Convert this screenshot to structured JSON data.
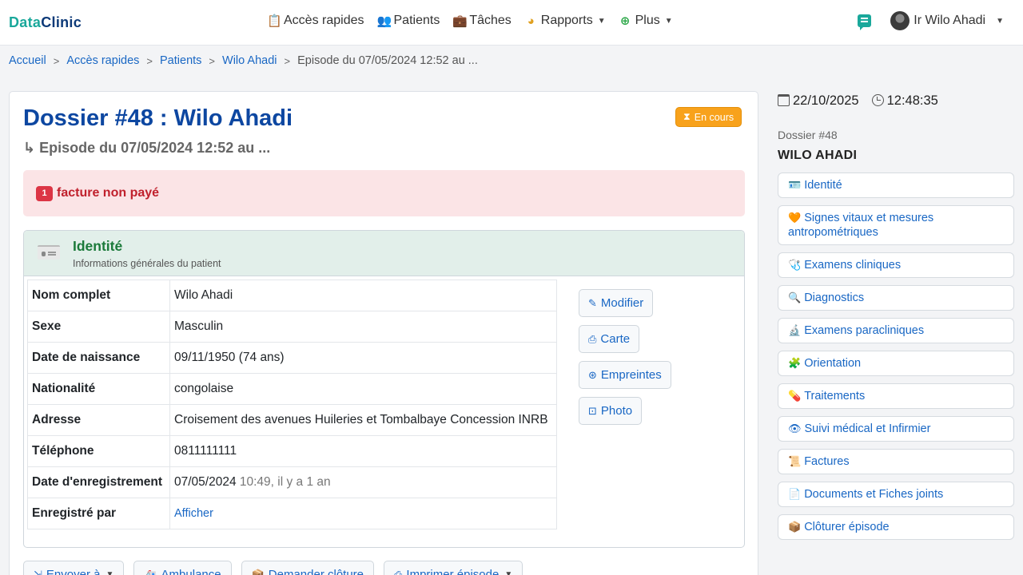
{
  "brand": {
    "part1": "Data",
    "part2": "Clinic"
  },
  "nav": {
    "items": [
      {
        "icon": "📋",
        "label": "Accès rapides",
        "caret": false
      },
      {
        "icon": "👥",
        "label": "Patients",
        "caret": false
      },
      {
        "icon": "💼",
        "label": "Tâches",
        "caret": false
      },
      {
        "icon": "◕",
        "label": "Rapports",
        "caret": true
      },
      {
        "icon": "⊕",
        "label": "Plus",
        "caret": true
      }
    ],
    "user": "Ir Wilo Ahadi"
  },
  "breadcrumb": {
    "items": [
      "Accueil",
      "Accès rapides",
      "Patients",
      "Wilo Ahadi"
    ],
    "current": "Episode du 07/05/2024 12:52 au ..."
  },
  "card": {
    "title": "Dossier #48 : Wilo Ahadi",
    "subtitle": "↳ Episode du 07/05/2024 12:52 au ...",
    "status": "En cours",
    "alert_count": "1",
    "alert_text": "facture non payé"
  },
  "identity": {
    "title": "Identité",
    "subtitle": "Informations générales du patient",
    "rows": [
      {
        "k": "Nom complet",
        "v": "Wilo Ahadi"
      },
      {
        "k": "Sexe",
        "v": "Masculin"
      },
      {
        "k": "Date de naissance",
        "v": "09/11/1950 (74 ans)"
      },
      {
        "k": "Nationalité",
        "v": "congolaise"
      },
      {
        "k": "Adresse",
        "v": "Croisement des avenues Huileries et Tombalbaye Concession INRB"
      },
      {
        "k": "Téléphone",
        "v": "0811111111"
      },
      {
        "k": "Date d'enregistrement",
        "v": "07/05/2024",
        "v2": " 10:49, il y a 1 an"
      },
      {
        "k": "Enregistré par",
        "link": "Afficher"
      }
    ],
    "actions": [
      {
        "icon": "✎",
        "label": "Modifier"
      },
      {
        "icon": "⎙",
        "label": "Carte"
      },
      {
        "icon": "⊛",
        "label": "Empreintes"
      },
      {
        "icon": "⊡",
        "label": "Photo"
      }
    ]
  },
  "bottom_buttons": [
    {
      "icon": "⇲",
      "label": "Envoyer à",
      "caret": true
    },
    {
      "icon": "🚑",
      "label": "Ambulance",
      "caret": false
    },
    {
      "icon": "📦",
      "label": "Demander clôture",
      "caret": false
    },
    {
      "icon": "⎙",
      "label": "Imprimer épisode",
      "caret": true
    }
  ],
  "side": {
    "date": "22/10/2025",
    "time": "12:48:35",
    "dossier": "Dossier #48",
    "name": "WILO AHADI",
    "items": [
      {
        "icon": "🪪",
        "label": "Identité"
      },
      {
        "icon": "🧡",
        "label": "Signes vitaux et mesures antropométriques"
      },
      {
        "icon": "🩺",
        "label": "Examens cliniques"
      },
      {
        "icon": "🔍",
        "label": "Diagnostics"
      },
      {
        "icon": "🔬",
        "label": "Examens paracliniques"
      },
      {
        "icon": "🧩",
        "label": "Orientation"
      },
      {
        "icon": "💊",
        "label": "Traitements"
      },
      {
        "icon": "👁",
        "label": "Suivi médical et Infirmier"
      },
      {
        "icon": "📜",
        "label": "Factures"
      },
      {
        "icon": "📄",
        "label": "Documents et Fiches joints"
      },
      {
        "icon": "📦",
        "label": "Clôturer épisode"
      }
    ]
  }
}
